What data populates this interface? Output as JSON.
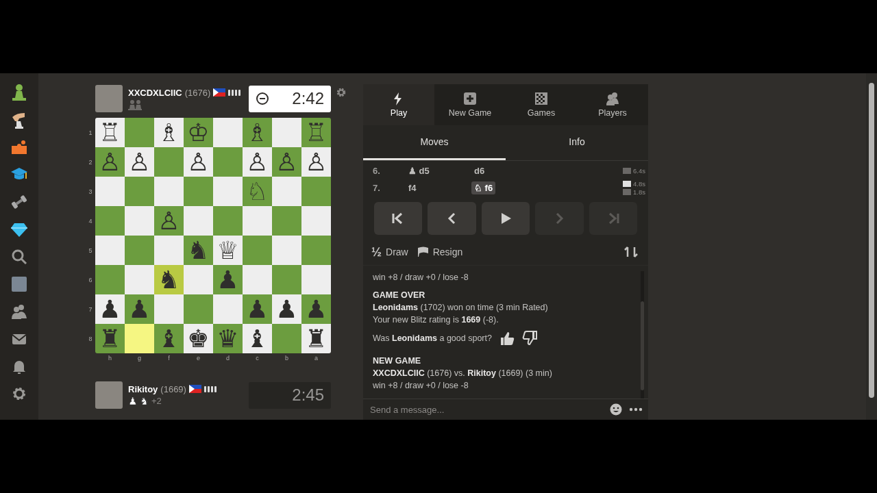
{
  "top_player": {
    "name": "XXCDXLCIIC",
    "rating": "(1676)",
    "clock": "2:42",
    "active": true
  },
  "board": {
    "rank_labels": [
      "1",
      "2",
      "3",
      "4",
      "5",
      "6",
      "7",
      "8"
    ],
    "file_labels": [
      "h",
      "g",
      "f",
      "e",
      "d",
      "c",
      "b",
      "a"
    ],
    "ranks": [
      {
        "squares": [
          {
            "glyph": "♖",
            "highlighted": false
          },
          {
            "highlighted": false
          },
          {
            "glyph": "♗",
            "highlighted": false
          },
          {
            "glyph": "♔",
            "highlighted": false
          },
          {
            "highlighted": false
          },
          {
            "glyph": "♗",
            "highlighted": false
          },
          {
            "highlighted": false
          },
          {
            "glyph": "♖",
            "highlighted": false
          }
        ]
      },
      {
        "squares": [
          {
            "glyph": "♙",
            "highlighted": false
          },
          {
            "glyph": "♙",
            "highlighted": false
          },
          {
            "highlighted": false
          },
          {
            "glyph": "♙",
            "highlighted": false
          },
          {
            "highlighted": false
          },
          {
            "glyph": "♙",
            "highlighted": false
          },
          {
            "glyph": "♙",
            "highlighted": false
          },
          {
            "glyph": "♙",
            "highlighted": false
          }
        ]
      },
      {
        "squares": [
          {
            "highlighted": false
          },
          {
            "highlighted": false
          },
          {
            "highlighted": false
          },
          {
            "highlighted": false
          },
          {
            "highlighted": false
          },
          {
            "glyph": "♘",
            "highlighted": false
          },
          {
            "highlighted": false
          },
          {
            "highlighted": false
          }
        ]
      },
      {
        "squares": [
          {
            "highlighted": false
          },
          {
            "highlighted": false
          },
          {
            "glyph": "♙",
            "highlighted": false
          },
          {
            "highlighted": false
          },
          {
            "highlighted": false
          },
          {
            "highlighted": false
          },
          {
            "highlighted": false
          },
          {
            "highlighted": false
          }
        ]
      },
      {
        "squares": [
          {
            "highlighted": false
          },
          {
            "highlighted": false
          },
          {
            "highlighted": false
          },
          {
            "glyph": "♞",
            "highlighted": false
          },
          {
            "glyph": "♕",
            "highlighted": false
          },
          {
            "highlighted": false
          },
          {
            "highlighted": false
          },
          {
            "highlighted": false
          }
        ]
      },
      {
        "squares": [
          {
            "highlighted": false
          },
          {
            "highlighted": false
          },
          {
            "glyph": "♞",
            "highlighted": true
          },
          {
            "highlighted": false
          },
          {
            "glyph": "♟",
            "highlighted": false
          },
          {
            "highlighted": false
          },
          {
            "highlighted": false
          },
          {
            "highlighted": false
          }
        ]
      },
      {
        "squares": [
          {
            "glyph": "♟",
            "highlighted": false
          },
          {
            "glyph": "♟",
            "highlighted": false
          },
          {
            "highlighted": false
          },
          {
            "highlighted": false
          },
          {
            "highlighted": false
          },
          {
            "glyph": "♟",
            "highlighted": false
          },
          {
            "glyph": "♟",
            "highlighted": false
          },
          {
            "glyph": "♟",
            "highlighted": false
          }
        ]
      },
      {
        "squares": [
          {
            "glyph": "♜",
            "highlighted": false
          },
          {
            "highlighted": true
          },
          {
            "glyph": "♝",
            "highlighted": false
          },
          {
            "glyph": "♚",
            "highlighted": false
          },
          {
            "glyph": "♛",
            "highlighted": false
          },
          {
            "glyph": "♝",
            "highlighted": false
          },
          {
            "highlighted": false
          },
          {
            "glyph": "♜",
            "highlighted": false
          }
        ]
      }
    ]
  },
  "bottom_player": {
    "name": "Rikitoy",
    "rating": "(1669)",
    "captured": [
      "♟",
      "♞"
    ],
    "advantage": "+2",
    "clock": "2:45",
    "active": false
  },
  "nav_tabs": [
    {
      "kind": "play",
      "label": "Play",
      "selected": true
    },
    {
      "kind": "new",
      "label": "New Game",
      "selected": false
    },
    {
      "kind": "games",
      "label": "Games",
      "selected": false
    },
    {
      "kind": "players",
      "label": "Players",
      "selected": false
    }
  ],
  "panel_tabs": [
    {
      "label": "Moves",
      "selected": true
    },
    {
      "label": "Info",
      "selected": false
    }
  ],
  "moves": [
    {
      "number": "6.",
      "white": {
        "figure": "♟",
        "san": "d5",
        "selected": false
      },
      "black": {
        "san": "d6",
        "selected": false
      },
      "times": [
        {
          "color": "#6a6866",
          "time": "6.4s"
        }
      ]
    },
    {
      "number": "7.",
      "white": {
        "san": "f4",
        "selected": false
      },
      "black": {
        "figure": "♘",
        "san": "f6",
        "selected": true
      },
      "times": [
        {
          "color": "#e0e0e0",
          "time": "4.8s"
        },
        {
          "color": "#6a6866",
          "time": "1.8s"
        }
      ]
    }
  ],
  "controls": [
    {
      "kind": "first",
      "disabled": false
    },
    {
      "kind": "previous",
      "disabled": false
    },
    {
      "kind": "play",
      "disabled": false
    },
    {
      "kind": "next",
      "disabled": true
    },
    {
      "kind": "last",
      "disabled": true
    }
  ],
  "actions": [
    {
      "kind": "draw",
      "glyph": "½",
      "label": "Draw"
    },
    {
      "kind": "resign",
      "label": "Resign"
    }
  ],
  "chat": [
    {
      "kind": "text",
      "text": "win +8 / draw +0 / lose -8"
    },
    {
      "kind": "heading",
      "text": "GAME OVER"
    },
    {
      "kind": "text",
      "text": "**Leonidams** (1702) won on time (3 min Rated)"
    },
    {
      "kind": "text",
      "text": "Your new Blitz rating is **1669** (-8)."
    },
    {
      "kind": "prompt",
      "text": "Was **Leonidams** a good sport?"
    },
    {
      "kind": "heading",
      "text": "NEW GAME"
    },
    {
      "kind": "text",
      "text": "**XXCDXLCIIC** (1676) vs. **Rikitoy** (1669) (3 min)"
    },
    {
      "kind": "text",
      "text": "win +8 / draw +0 / lose -8"
    }
  ],
  "message_input": {
    "placeholder": "Send a message..."
  }
}
